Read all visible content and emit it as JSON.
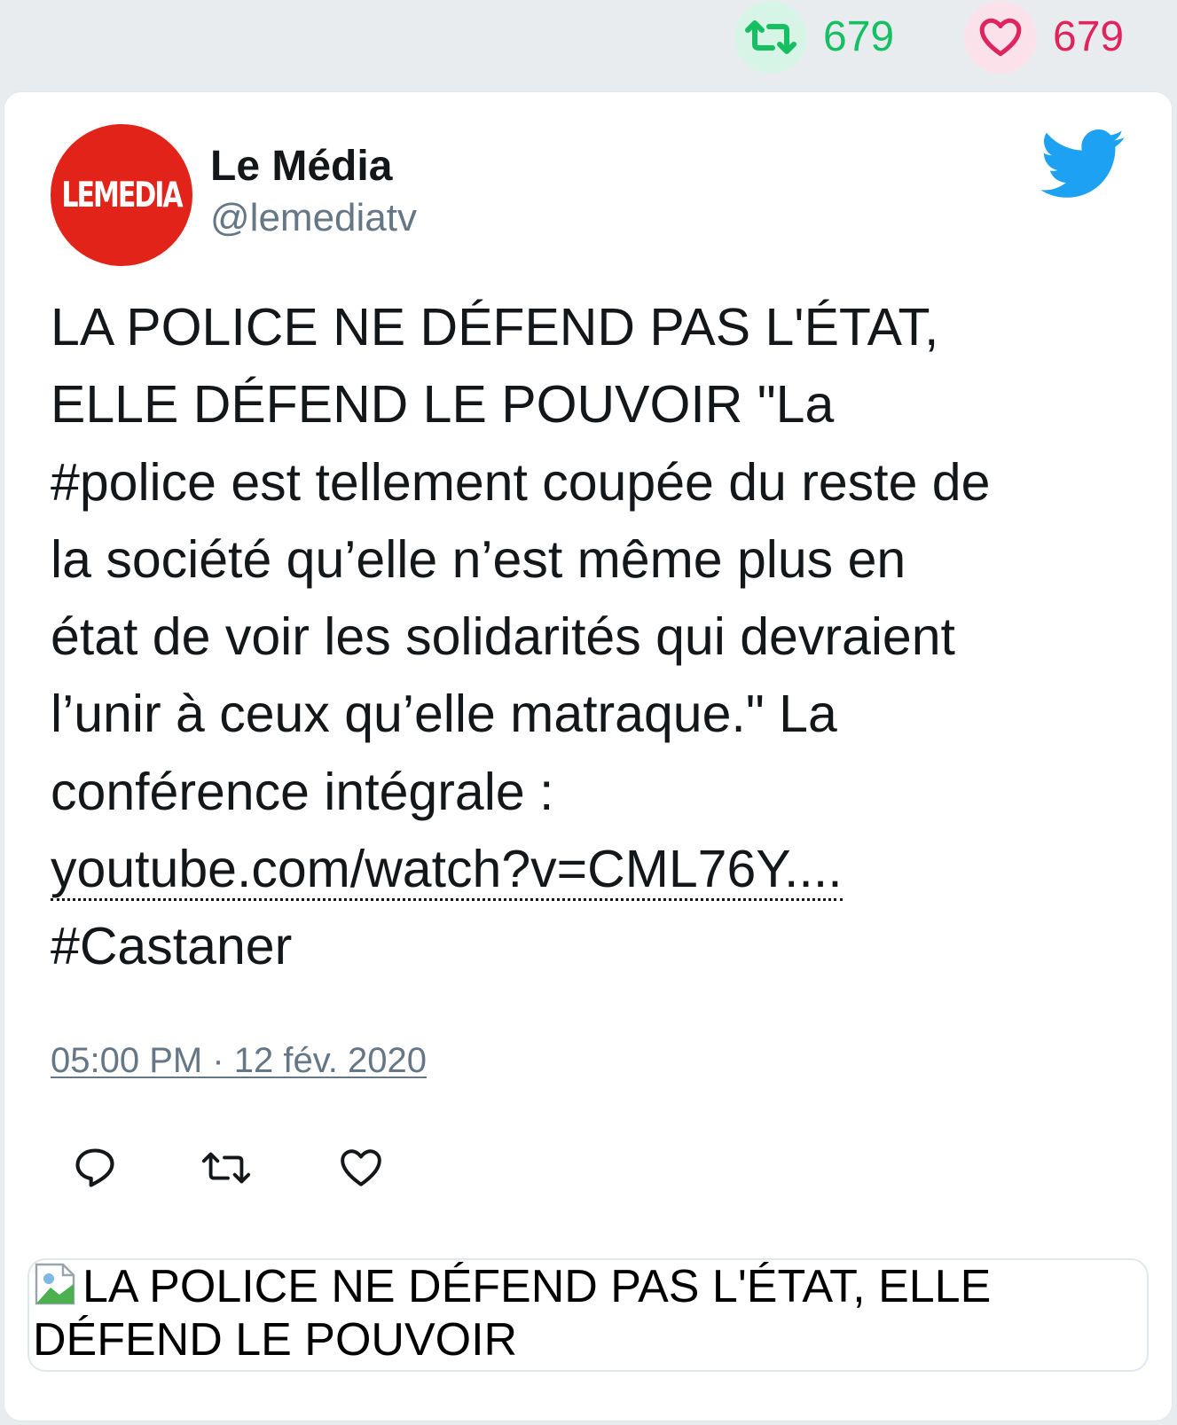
{
  "top_stats": {
    "retweets": "679",
    "likes": "679"
  },
  "tweet": {
    "author": {
      "display_name": "Le Média",
      "handle": "@lemediatv",
      "avatar_text": "LEMEDIA"
    },
    "text_lines": [
      "LA POLICE NE DÉFEND PAS L'ÉTAT,",
      "ELLE DÉFEND LE POUVOIR \"La",
      "#police est tellement coupée du reste de",
      "la société qu’elle n’est même plus en",
      "état de voir les solidarités qui devraient",
      "l’unir à ceux qu’elle matraque.\" La",
      "conférence intégrale :"
    ],
    "link_text": "youtube.com/watch?v=CML76Y....",
    "hashtag": "#Castaner",
    "timestamp": "05:00 PM · 12 fév. 2020"
  },
  "link_card": {
    "title": "LA POLICE NE DÉFEND PAS L'ÉTAT, ELLE DÉFEND LE POUVOIR"
  },
  "colors": {
    "retweet_green": "#17bf63",
    "like_red": "#e0245e",
    "twitter_blue": "#1da1f2",
    "avatar_red": "#e2231a",
    "secondary_gray": "#657786"
  },
  "icons": {
    "retweet": "retweet-icon",
    "like": "heart-icon",
    "reply": "reply-icon",
    "brand": "twitter-bird-icon"
  }
}
